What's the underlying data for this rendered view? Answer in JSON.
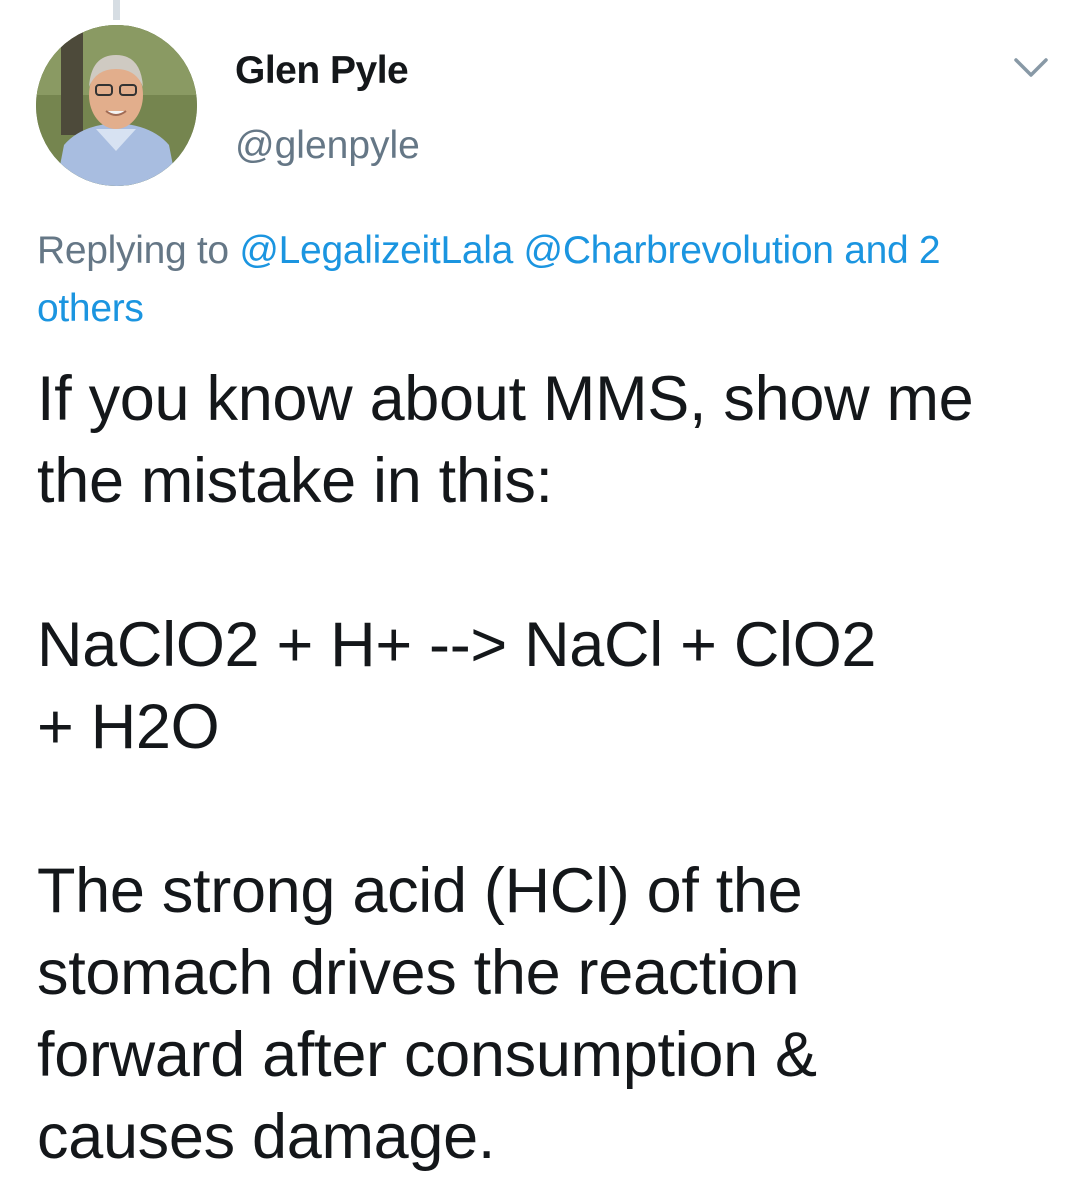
{
  "tweet": {
    "author": {
      "display_name": "Glen Pyle",
      "handle": "@glenpyle",
      "avatar_icon": "profile-photo"
    },
    "menu_icon": "chevron-down-icon",
    "reply_context": {
      "prefix": "Replying to",
      "mentions": [
        "@LegalizeitLala",
        "@Charbrevolution"
      ],
      "conjunction": "and",
      "others": "2 others"
    },
    "body": {
      "paragraph_1": "If you know about MMS, show me\nthe mistake in this:",
      "paragraph_2": "NaClO2 + H+ --> NaCl + ClO2\n+ H2O",
      "paragraph_3": "The strong acid (HCl) of the\nstomach drives the reaction\nforward after consumption &\ncauses damage."
    }
  },
  "colors": {
    "text_primary": "#14171a",
    "text_secondary": "#657786",
    "link": "#1b95e0",
    "thread_line": "#d6dde3"
  }
}
